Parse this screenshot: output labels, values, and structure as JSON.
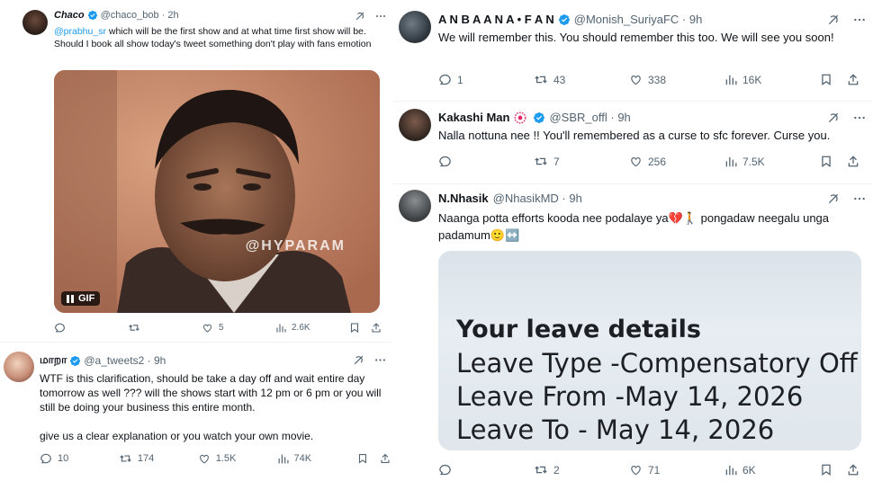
{
  "left": {
    "tweet1": {
      "name": "Chaco",
      "handle": "@chaco_bob",
      "time": "2h",
      "mention": "@prabhu_sr",
      "text_rest": " which will be the first show and at what time first show will be. Should I book all show today's tweet something don't play with fans emotion",
      "media": {
        "badge": "GIF",
        "watermark": "@HYPARAM"
      },
      "stats": {
        "replies": "",
        "retweets": "",
        "likes": "5",
        "views": "2.6K"
      }
    },
    "tweet2": {
      "name": "மாறா",
      "handle": "@a_tweets2",
      "time": "9h",
      "text": "WTF is this clarification, should be take a day off and wait entire day tomorrow as well ??? will the shows start with 12  pm or 6 pm or you will still be doing your business this entire month.",
      "text2": "give us a clear explanation or you watch your own movie.",
      "stats": {
        "replies": "10",
        "retweets": "174",
        "likes": "1.5K",
        "views": "74K"
      }
    }
  },
  "right": {
    "tweet1": {
      "name": "A N B A A N A • F A N",
      "handle": "@Monish_SuriyaFC",
      "time": "9h",
      "text": "We will remember this. You should remember this too. We will see you soon!",
      "stats": {
        "replies": "1",
        "retweets": "43",
        "likes": "338",
        "views": "16K"
      }
    },
    "tweet2": {
      "name": "Kakashi Man",
      "handle": "@SBR_offl",
      "time": "9h",
      "text": "Nalla nottuna nee !! You'll remembered as a curse to sfc forever. Curse you.",
      "stats": {
        "replies": "",
        "retweets": "7",
        "likes": "256",
        "views": "7.5K"
      }
    },
    "tweet3": {
      "name": "N.Nhasik",
      "handle": "@NhasikMD",
      "time": "9h",
      "text": "Naanga potta efforts kooda nee podalaye ya💔🚶 pongadaw neegalu unga padamum🙂↔️",
      "media": {
        "heading": "Your leave details",
        "line1": "Leave Type -Compensatory Off",
        "line2": "Leave From -May 14, 2026",
        "line3": "Leave To - May 14, 2026"
      },
      "stats": {
        "replies": "",
        "retweets": "2",
        "likes": "71",
        "views": "6K"
      }
    }
  },
  "colors": {
    "verified": "#1d9bf0",
    "muted": "#536471",
    "link": "#1d9bf0"
  }
}
